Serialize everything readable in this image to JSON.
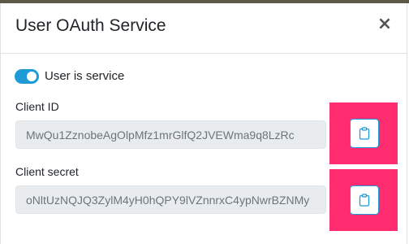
{
  "modal": {
    "title": "User OAuth Service",
    "close_glyph": "×",
    "close_icon": "close-icon"
  },
  "service_toggle": {
    "label": "User is service",
    "checked": true,
    "color": "#1e9bd7"
  },
  "client_id": {
    "label": "Client ID",
    "value": "MwQu1ZznobeAgOlpMfz1mrGlfQ2JVEWma9q8LzRc",
    "copy_icon": "clipboard-icon"
  },
  "client_secret": {
    "label": "Client secret",
    "value": "oNltUzNQJQ3ZylM4yH0hQPY9lVZnnrxC4ypNwrBZNMy",
    "copy_icon": "clipboard-icon"
  },
  "colors": {
    "highlight": "#ff2d70",
    "accent": "#1e9bd7",
    "readonly_field": "#e9ecef"
  }
}
